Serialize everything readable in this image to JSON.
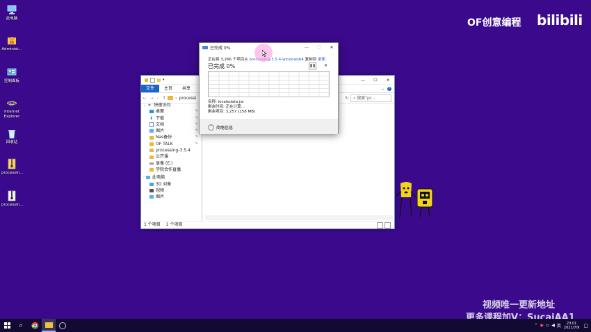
{
  "desktop": {
    "icons": [
      {
        "label": "此电脑",
        "icon": "this-pc-icon"
      },
      {
        "label": "Administ...",
        "icon": "user-folder-icon"
      },
      {
        "label": "控制面板",
        "icon": "control-panel-icon"
      },
      {
        "label": "Internet Explorer",
        "icon": "ie-icon"
      },
      {
        "label": "回收站",
        "icon": "recycle-bin-icon"
      },
      {
        "label": "processin...",
        "icon": "zip-icon"
      },
      {
        "label": "processin...",
        "icon": "zip-icon"
      }
    ]
  },
  "watermark": {
    "brand": "OF创意编程",
    "logo": "bilibili",
    "line1": "视频唯一更新地址",
    "line2": "更多课程加V：SucaiAA1"
  },
  "explorer": {
    "tabs": [
      "文件",
      "主页",
      "共享",
      "查"
    ],
    "address": "processi",
    "search_placeholder": "搜索\"pr...",
    "column_header": "大小",
    "nav_items": [
      {
        "label": "快速访问",
        "icon": "star-icon",
        "pinned": false
      },
      {
        "label": "桌面",
        "icon": "desktop-folder-icon",
        "pinned": true
      },
      {
        "label": "下载",
        "icon": "download-icon",
        "pinned": true
      },
      {
        "label": "文档",
        "icon": "document-icon",
        "pinned": true
      },
      {
        "label": "图片",
        "icon": "pictures-icon",
        "pinned": true
      },
      {
        "label": "Nas备份",
        "icon": "folder-icon",
        "pinned": true
      },
      {
        "label": "OF TALK",
        "icon": "folder-icon",
        "pinned": true
      },
      {
        "label": "processing-3.5.4",
        "icon": "folder-icon",
        "pinned": false
      },
      {
        "label": "公开课",
        "icon": "folder-icon",
        "pinned": false
      },
      {
        "label": "录像 (E:)",
        "icon": "drive-icon",
        "pinned": false
      },
      {
        "label": "学院合作直播",
        "icon": "folder-icon",
        "pinned": false
      },
      {
        "label": "此电脑",
        "icon": "this-pc-icon",
        "pinned": false
      },
      {
        "label": "3D 对象",
        "icon": "3d-objects-icon",
        "pinned": false
      },
      {
        "label": "视频",
        "icon": "video-icon",
        "pinned": false
      },
      {
        "label": "图片",
        "icon": "pictures-icon",
        "pinned": false
      }
    ],
    "status": {
      "count": "1 个项目",
      "selected": "1 个项目"
    }
  },
  "dialog": {
    "title": "已完成 0%",
    "line_prefix": "正在将 3,266 个项目从",
    "source": "processing-3.5.4-windows64",
    "line_mid": "复制到",
    "dest": "桌面",
    "percent": "已完成 0%",
    "progress": 0,
    "name_label": "名称: localedata.jar",
    "time_label": "剩余时间: 正在计算...",
    "items_label": "剩余项目: 3,257 (258 MB)",
    "details": "简略信息"
  },
  "taskbar": {
    "time": "23:01",
    "date": "2021/7/9",
    "lang": "英"
  },
  "colors": {
    "desktop": "#3b0a8c",
    "accent": "#1a63c9",
    "taskbar": "#120a33"
  }
}
